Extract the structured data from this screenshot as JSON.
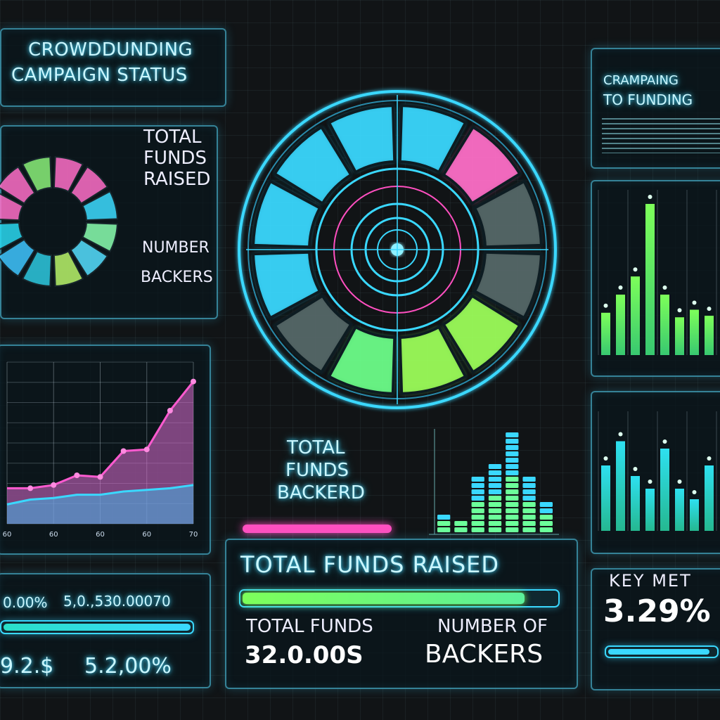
{
  "header": {
    "title_line1": "CROWDDUNDING",
    "title_line2": "CAMPAIGN STATUS"
  },
  "left_panel": {
    "label_total_line1": "TOTAL",
    "label_total_line2": "FUNDS",
    "label_total_line3": "RAISED",
    "label_number": "NUMBER",
    "label_backers": "BACKERS"
  },
  "top_right_panel": {
    "title_line1": "CRAMPAING",
    "title_line2": "TO FUNDING"
  },
  "line_chart_panel": {
    "x_ticks": [
      "60",
      "60",
      "60",
      "60",
      "70"
    ]
  },
  "center": {
    "label_total": "TOTAL",
    "label_funds": "FUNDS",
    "label_backed": "BACKERD"
  },
  "funds_panel": {
    "title": "TOTAL FUNDS RAISED",
    "total_funds_label": "TOTAL FUNDS",
    "total_funds_value": "32.0.00S",
    "backers_label": "NUMBER OF",
    "backers_value": "BACKERS",
    "progress": 0.9
  },
  "bottom_left_panel": {
    "stat1": "0.00%",
    "stat2": "5,0.,530.00070",
    "stat3": "9.2.$",
    "stat4": "5.2,00%",
    "progress": 1.0
  },
  "key_metrics_panel": {
    "title": "KEY MET",
    "value": "3.29%",
    "progress": 0.95
  },
  "chart_data": [
    {
      "type": "line",
      "x": [
        0,
        1,
        2,
        3,
        4,
        5,
        6,
        7,
        8
      ],
      "series": [
        {
          "values": [
            22,
            22,
            24,
            30,
            29,
            45,
            46,
            70,
            88
          ]
        },
        {
          "values": [
            12,
            15,
            16,
            18,
            18,
            20,
            21,
            22,
            24
          ]
        }
      ],
      "ylim": [
        0,
        100
      ]
    },
    {
      "type": "bar",
      "categories": [
        "1",
        "2",
        "3",
        "4",
        "5",
        "6",
        "7",
        "8"
      ],
      "values": [
        28,
        40,
        52,
        100,
        40,
        25,
        30,
        26
      ],
      "ylim": [
        0,
        100
      ]
    },
    {
      "type": "bar",
      "categories": [
        "1",
        "2",
        "3",
        "4",
        "5",
        "6",
        "7",
        "8"
      ],
      "values": [
        62,
        85,
        52,
        40,
        78,
        40,
        30,
        62
      ],
      "ylim": [
        0,
        100
      ]
    },
    {
      "type": "bar",
      "categories": [
        "1",
        "2",
        "3",
        "4",
        "5",
        "6",
        "7"
      ],
      "values": [
        20,
        15,
        55,
        70,
        100,
        60,
        30
      ],
      "ylim": [
        0,
        100
      ]
    },
    {
      "type": "pie",
      "values": [
        1,
        1,
        1,
        1,
        1,
        1,
        1,
        1,
        1,
        1,
        1,
        1
      ],
      "colors": [
        "#ff6fc8",
        "#ff6fc8",
        "#3ddcff",
        "#8affb0",
        "#56e0ff",
        "#b9f56a",
        "#2ec9e0",
        "#3fc6ff",
        "#2ad8f0",
        "#ff6fc8",
        "#ff6fc8",
        "#8af07a"
      ]
    }
  ],
  "colors": {
    "cyan": "#3ad8ff",
    "pink": "#ff4fc0",
    "green": "#7dff5a",
    "teal": "#28e0c0"
  }
}
